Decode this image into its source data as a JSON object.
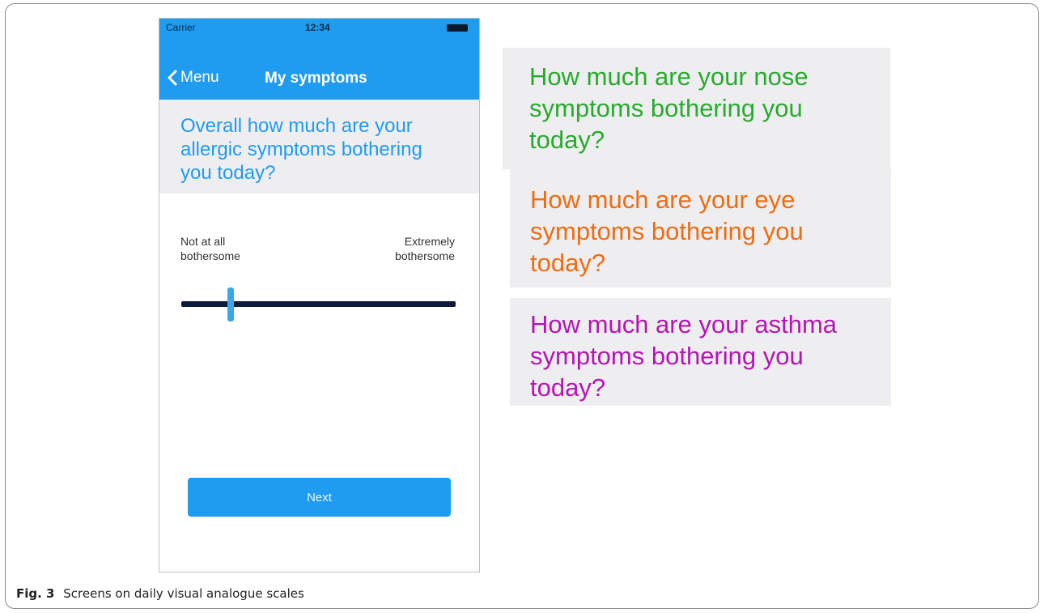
{
  "status_bar": {
    "carrier": "Carrier",
    "time": "12:34"
  },
  "nav": {
    "back_label": "Menu",
    "title": "My symptoms"
  },
  "question": {
    "text": "Overall how much are your allergic symptoms bothering you today?"
  },
  "scale": {
    "left_label_line1": "Not at all",
    "left_label_line2": "bothersome",
    "right_label_line1": "Extremely",
    "right_label_line2": "bothersome",
    "slider_value_fraction": 0.18
  },
  "next_button_label": "Next",
  "side_questions": [
    {
      "line1": "How much are your nose",
      "line2": "symptoms bothering you",
      "line3": "today?",
      "color": "#27ab2d"
    },
    {
      "line1": "How much are your eye",
      "line2": "symptoms bothering you",
      "line3": "today?",
      "color": "#ef6c11"
    },
    {
      "line1": "How much are your asthma",
      "line2": "symptoms bothering you",
      "line3": "today?",
      "color": "#b614b5"
    }
  ],
  "caption": {
    "label": "Fig. 3",
    "text": "Screens on daily visual analogue scales"
  },
  "colors": {
    "accent": "#1f9bef",
    "slider_track": "#0d1b3a",
    "panel_bg": "#eeeef0"
  }
}
